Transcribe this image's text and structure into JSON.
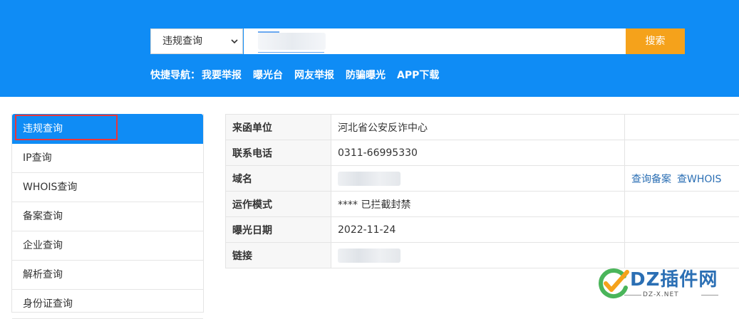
{
  "header": {
    "search": {
      "select_value": "违规查询",
      "input_value": "",
      "button_label": "搜索"
    },
    "quicknav": {
      "label": "快捷导航：",
      "links": [
        "我要举报",
        "曝光台",
        "网友举报",
        "防骗曝光",
        "APP下载"
      ]
    }
  },
  "sidebar": {
    "items": [
      "违规查询",
      "IP查询",
      "WHOIS查询",
      "备案查询",
      "企业查询",
      "解析查询",
      "身份证查询"
    ],
    "active": "违规查询"
  },
  "details": {
    "rows": [
      {
        "key": "来函单位",
        "value": "河北省公安反诈中心"
      },
      {
        "key": "联系电话",
        "value": "0311-66995330"
      },
      {
        "key": "域名",
        "value": ""
      },
      {
        "key": "运作模式",
        "value": "**** 已拦截封禁"
      },
      {
        "key": "曝光日期",
        "value": "2022-11-24"
      },
      {
        "key": "链接",
        "value": ""
      }
    ],
    "actions": {
      "query_icp": "查询备案",
      "query_whois": "查WHOIS"
    }
  },
  "watermark": {
    "text": "DZ插件网",
    "sub": "DZ-X.NET"
  },
  "colors": {
    "header_blue": "#0f8cf5",
    "button_orange": "#f5a21b",
    "highlight_red": "#e8363b",
    "link_blue": "#2b6fb4"
  },
  "icons": {
    "select_arrow": "chevron-down-icon",
    "watermark_logo": "checkmark-logo-icon"
  }
}
